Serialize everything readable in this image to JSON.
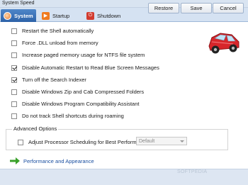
{
  "window": {
    "title": "System Speed"
  },
  "tabs": [
    {
      "label": "System",
      "icon": "system-icon",
      "active": true
    },
    {
      "label": "Startup",
      "icon": "startup-icon",
      "active": false
    },
    {
      "label": "Shutdown",
      "icon": "shutdown-icon",
      "active": false
    }
  ],
  "options": [
    {
      "label": "Restart the Shell automatically",
      "checked": false
    },
    {
      "label": "Force .DLL unload from memory",
      "checked": false
    },
    {
      "label": "Increase paged memory usage for NTFS file system",
      "checked": false
    },
    {
      "label": "Disable Automatic Restart to Read Blue Screen Messages",
      "checked": true
    },
    {
      "label": "Turn off the Search Indexer",
      "checked": true
    },
    {
      "label": "Disable Windows Zip and Cab Compressed Folders",
      "checked": false
    },
    {
      "label": "Disable Windows Program Compatibility Assistant",
      "checked": false
    },
    {
      "label": "Do not track Shell shortcuts during roaming",
      "checked": false
    }
  ],
  "advanced": {
    "legend": "Advanced Options",
    "option_label": "Adjust Processor Scheduling for Best Performance of",
    "option_checked": false,
    "dropdown_value": "Default"
  },
  "link": {
    "label": "Performance and Appearance"
  },
  "buttons": {
    "restore": "Restore",
    "save": "Save",
    "cancel": "Cancel"
  },
  "watermark": "SOFTPEDIA",
  "colors": {
    "accent": "#2d62a8",
    "tabbar": "#d5e2f2",
    "link": "#1a4fa0",
    "arrow": "#3aa12b",
    "car": "#d7262b"
  }
}
